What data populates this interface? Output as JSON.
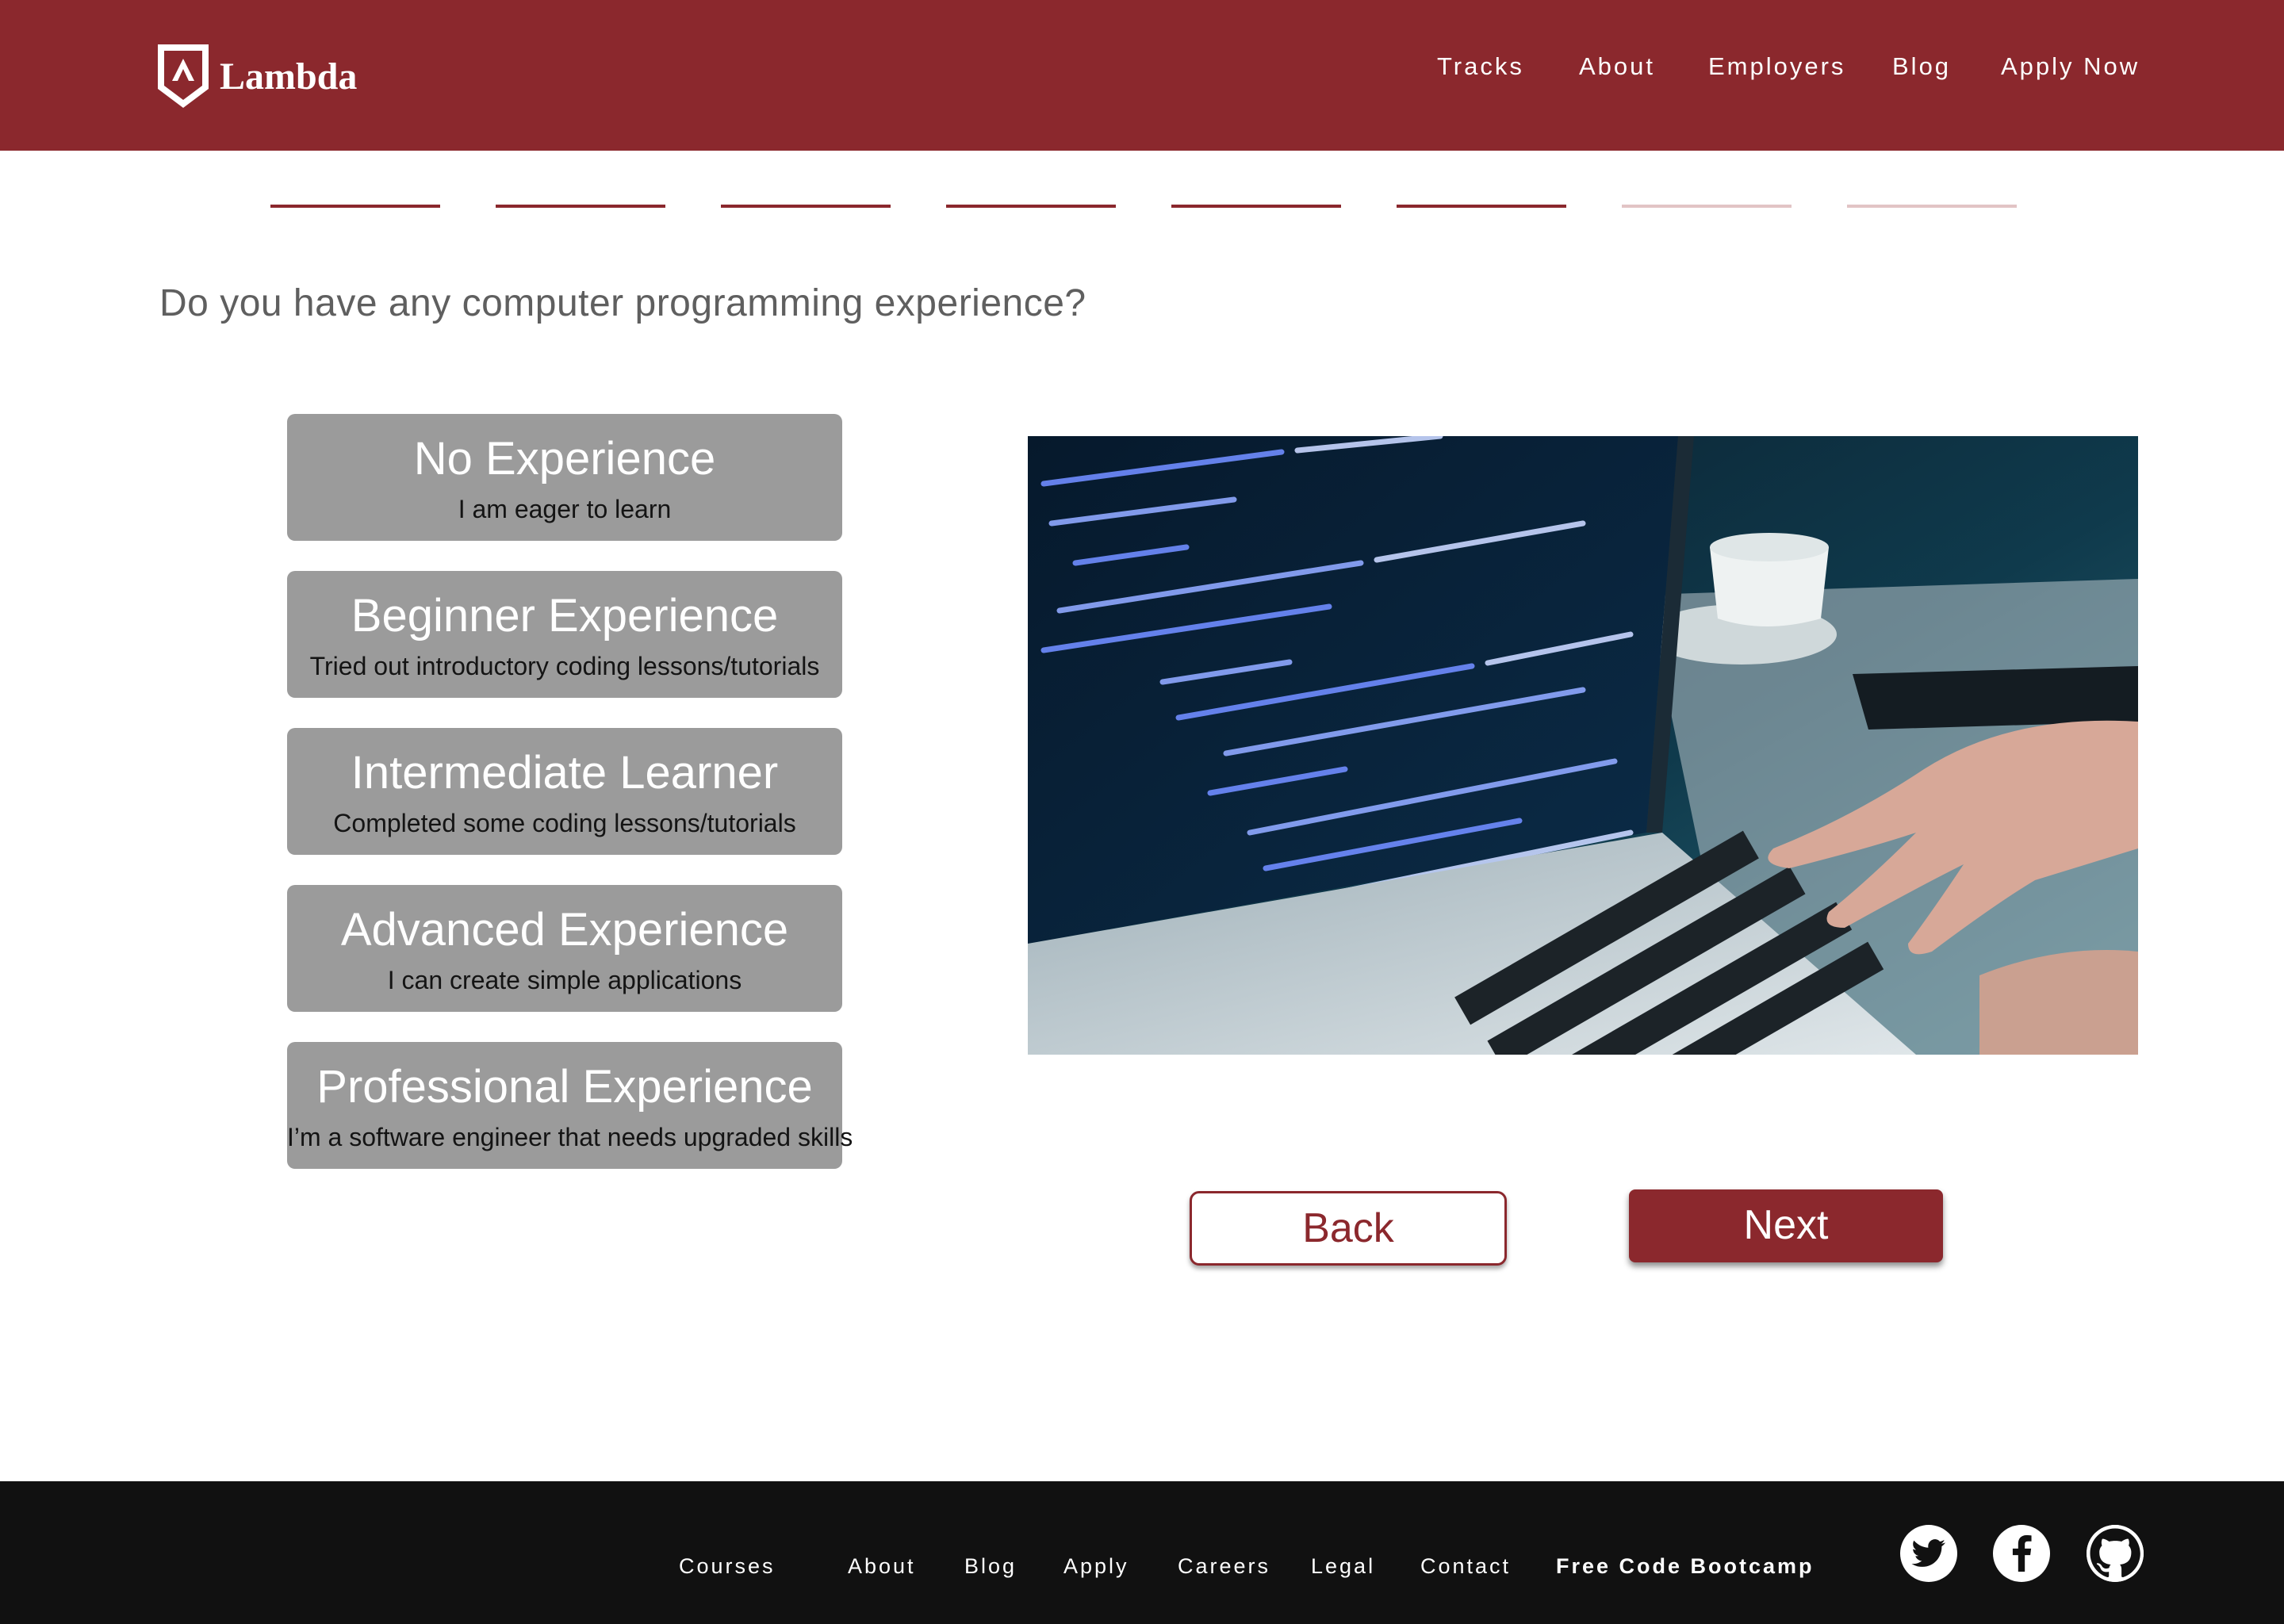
{
  "header": {
    "brand": "Lambda",
    "nav": [
      "Tracks",
      "About",
      "Employers",
      "Blog",
      "Apply Now"
    ]
  },
  "progress": {
    "total_steps": 8,
    "completed_steps": 6,
    "active_color": "#8b282d",
    "pending_color": "#e2c4c5"
  },
  "question": "Do you have any computer programming experience?",
  "options": [
    {
      "title": "No Experience",
      "subtitle": "I am eager to learn"
    },
    {
      "title": "Beginner Experience",
      "subtitle": "Tried out introductory coding lessons/tutorials"
    },
    {
      "title": "Intermediate Learner",
      "subtitle": "Completed some coding lessons/tutorials"
    },
    {
      "title": "Advanced Experience",
      "subtitle": "I can create simple applications"
    },
    {
      "title": "Professional Experience",
      "subtitle": "I’m a software engineer that needs upgraded skills"
    }
  ],
  "photo": {
    "icon": "laptop-code-photo"
  },
  "buttons": {
    "back": "Back",
    "next": "Next"
  },
  "footer": {
    "links": [
      "Courses",
      "About",
      "Blog",
      "Apply",
      "Careers",
      "Legal",
      "Contact",
      "Free Code Bootcamp"
    ],
    "social": [
      "twitter-icon",
      "facebook-icon",
      "github-icon"
    ]
  },
  "colors": {
    "brand": "#8b282d",
    "option_bg": "#9b9b9b",
    "footer_bg": "#111111"
  }
}
